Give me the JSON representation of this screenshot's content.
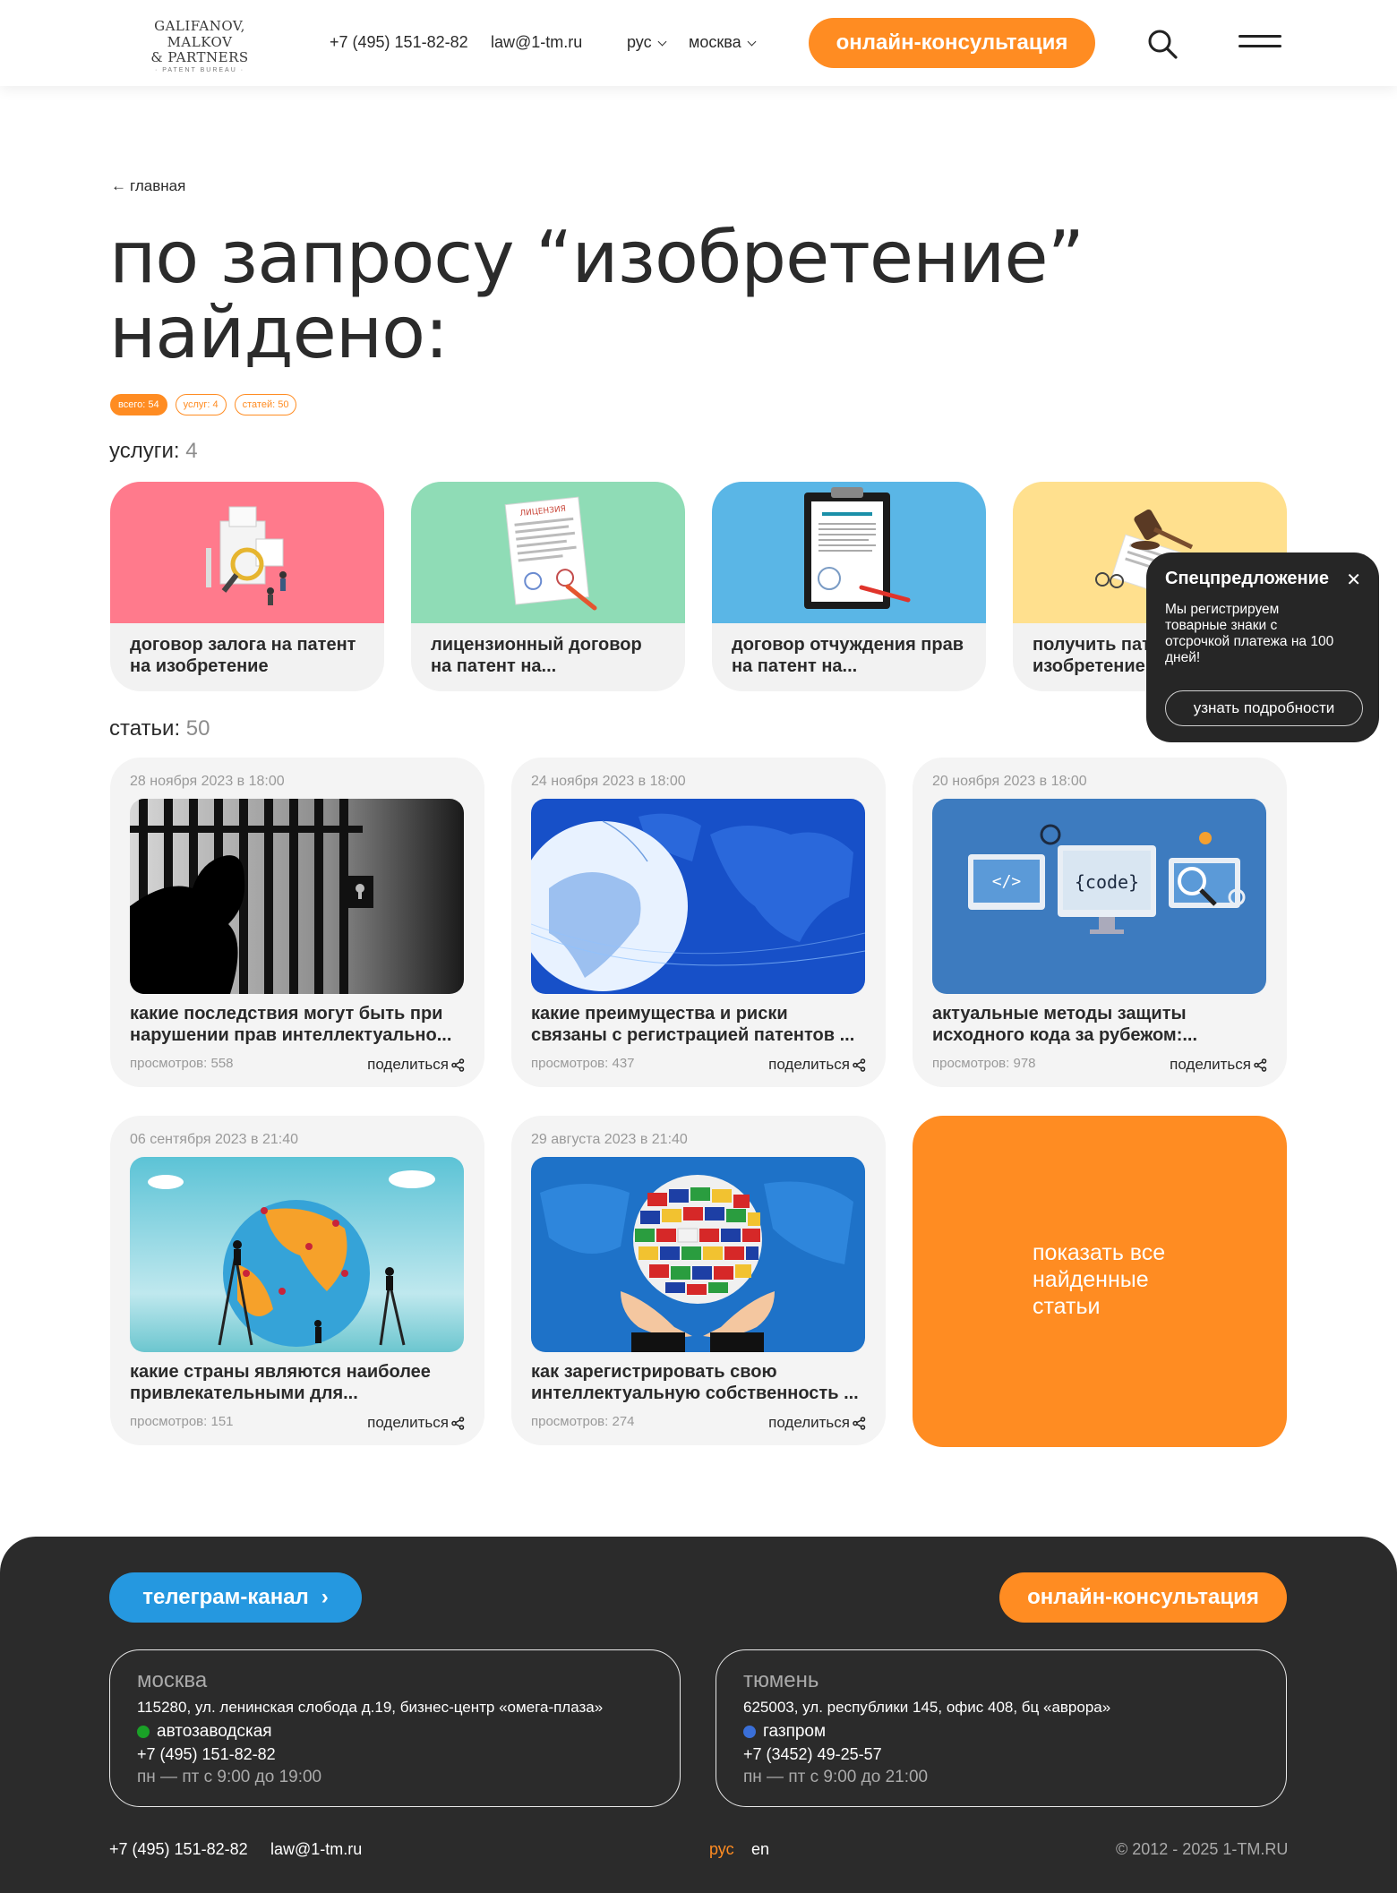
{
  "header": {
    "logo_line1": "GALIFANOV, MALKOV",
    "logo_line2": "& PARTNERS",
    "logo_line3": "· PATENT BUREAU ·",
    "phone": "+7 (495) 151-82-82",
    "email": "law@1-tm.ru",
    "lang": "рус",
    "city": "москва",
    "cta": "онлайн-консультация"
  },
  "breadcrumb": {
    "arrow": "←",
    "label": "главная"
  },
  "title": {
    "line1": "по запросу “изобретение”",
    "line2": "найдено:"
  },
  "chips": [
    "всего: 54",
    "услуг: 4",
    "статей: 50"
  ],
  "services": {
    "label": "услуги:",
    "count": "4",
    "items": [
      {
        "title": "договор залога на патент на изобретение",
        "bg": "#ff7a8c"
      },
      {
        "title": "лицензионный договор на патент на...",
        "bg": "#8fdcb6",
        "doc_label": "ЛИЦЕНЗИЯ"
      },
      {
        "title": "договор отчуждения прав на патент на...",
        "bg": "#5ab6e6"
      },
      {
        "title": "получить патент на изобретение",
        "bg": "#ffe08e"
      }
    ]
  },
  "promo": {
    "title": "Спецпредложение",
    "close": "✕",
    "text": "Мы регистрируем товарные знаки с отсрочкой платежа на 100 дней!",
    "button": "узнать подробности"
  },
  "articles": {
    "label": "статьи:",
    "count": "50",
    "share_label": "поделиться",
    "items": [
      {
        "date": "28 ноября 2023 в 18:00",
        "title": "какие последствия могут быть при нарушении прав интеллектуально...",
        "views": "просмотров: 558"
      },
      {
        "date": "24 ноября 2023 в 18:00",
        "title": "какие преимущества и риски связаны с регистрацией патентов ...",
        "views": "просмотров: 437"
      },
      {
        "date": "20 ноября 2023 в 18:00",
        "title": "актуальные методы защиты исходного кода за рубежом:...",
        "views": "просмотров: 978",
        "code_label": "{code}",
        "code_tag": "</>"
      },
      {
        "date": "06 сентября 2023 в 21:40",
        "title": "какие страны являются наиболее привлекательными для...",
        "views": "просмотров: 151"
      },
      {
        "date": "29 августа 2023 в 21:40",
        "title": "как зарегистрировать свою интеллектуальную собственность ...",
        "views": "просмотров: 274"
      }
    ],
    "show_all": "показать все найденные статьи"
  },
  "footer": {
    "telegram": "телеграм-канал",
    "telegram_arrow": "›",
    "cta": "онлайн-консультация",
    "offices": [
      {
        "city": "москва",
        "address": "115280, ул. ленинская слобода д.19, бизнес-центр «омега-плаза»",
        "metro": "автозаводская",
        "phone": "+7 (495) 151-82-82",
        "hours": "пн — пт с 9:00 до 19:00"
      },
      {
        "city": "тюмень",
        "address": "625003, ул. республики 145, офис 408, бц «аврора»",
        "metro": "газпром",
        "phone": "+7 (3452) 49-25-57",
        "hours": "пн — пт с 9:00 до 21:00"
      }
    ],
    "phone": "+7 (495) 151-82-82",
    "email": "law@1-tm.ru",
    "lang_ru": "рус",
    "lang_en": "en",
    "copyright": "© 2012 - 2025 1-TM.RU"
  },
  "colors": {
    "accent": "#ff8c22",
    "telegram": "#2598e0",
    "dark": "#2b2b2b"
  },
  "icons": [
    "arrow-left-icon",
    "chevron-down-icon",
    "search-icon",
    "menu-icon",
    "close-icon",
    "share-icon",
    "chevron-right-icon",
    "metro-icon"
  ]
}
